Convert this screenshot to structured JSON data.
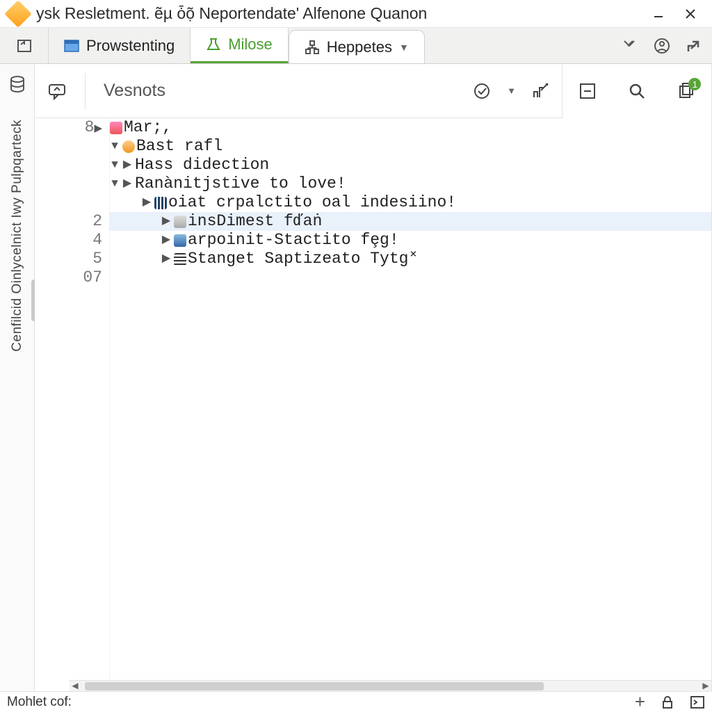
{
  "window": {
    "title": "ysk Resletment. ẽµ  ȱọ̃ Neportendate' Alfenone Quanon"
  },
  "tabs": [
    {
      "label": "Prowstenting"
    },
    {
      "label": "Milose"
    },
    {
      "label": "Heppetes"
    }
  ],
  "toolbar": {
    "vesnots": "Vesnots"
  },
  "badge": {
    "count": "1"
  },
  "sidebar": {
    "vlabel": "Cenfilcid Oinlycelnict Iwy Pulpqarteck"
  },
  "tree": [
    {
      "gutter": "8",
      "tri": "right",
      "indent": 0,
      "icon": "red",
      "text": "Mar;,"
    },
    {
      "gutter": "",
      "tri": "down",
      "indent": 0,
      "icon": "orange",
      "text": "Bast rafl"
    },
    {
      "gutter": "",
      "tri": "down",
      "indent": 0,
      "tri2": "right",
      "text": "Hass didection"
    },
    {
      "gutter": "",
      "tri": "down",
      "indent": 0,
      "tri2": "right",
      "text": "Ranànitjstive to love!"
    },
    {
      "gutter": "",
      "tri": "",
      "indent": 1,
      "tri2": "right",
      "icon": "bars",
      "text": "oiat crpalctito oal indesiino!"
    },
    {
      "gutter": "2",
      "tri": "",
      "indent": 2,
      "tri2": "right",
      "icon": "doc",
      "text": "insDimest fďaṅ",
      "selected": true
    },
    {
      "gutter": "4",
      "tri": "",
      "indent": 2,
      "tri2": "right",
      "icon": "blue",
      "text": "arpoinit-Stactito fȩg!"
    },
    {
      "gutter": "5",
      "tri": "",
      "indent": 2,
      "tri2": "right",
      "icon": "list",
      "text": "Stanget Saptizeato Tytg˟"
    },
    {
      "gutter": "07",
      "tri": "",
      "indent": 0,
      "text": ""
    }
  ],
  "status": {
    "left": "Mohlet cof:"
  }
}
